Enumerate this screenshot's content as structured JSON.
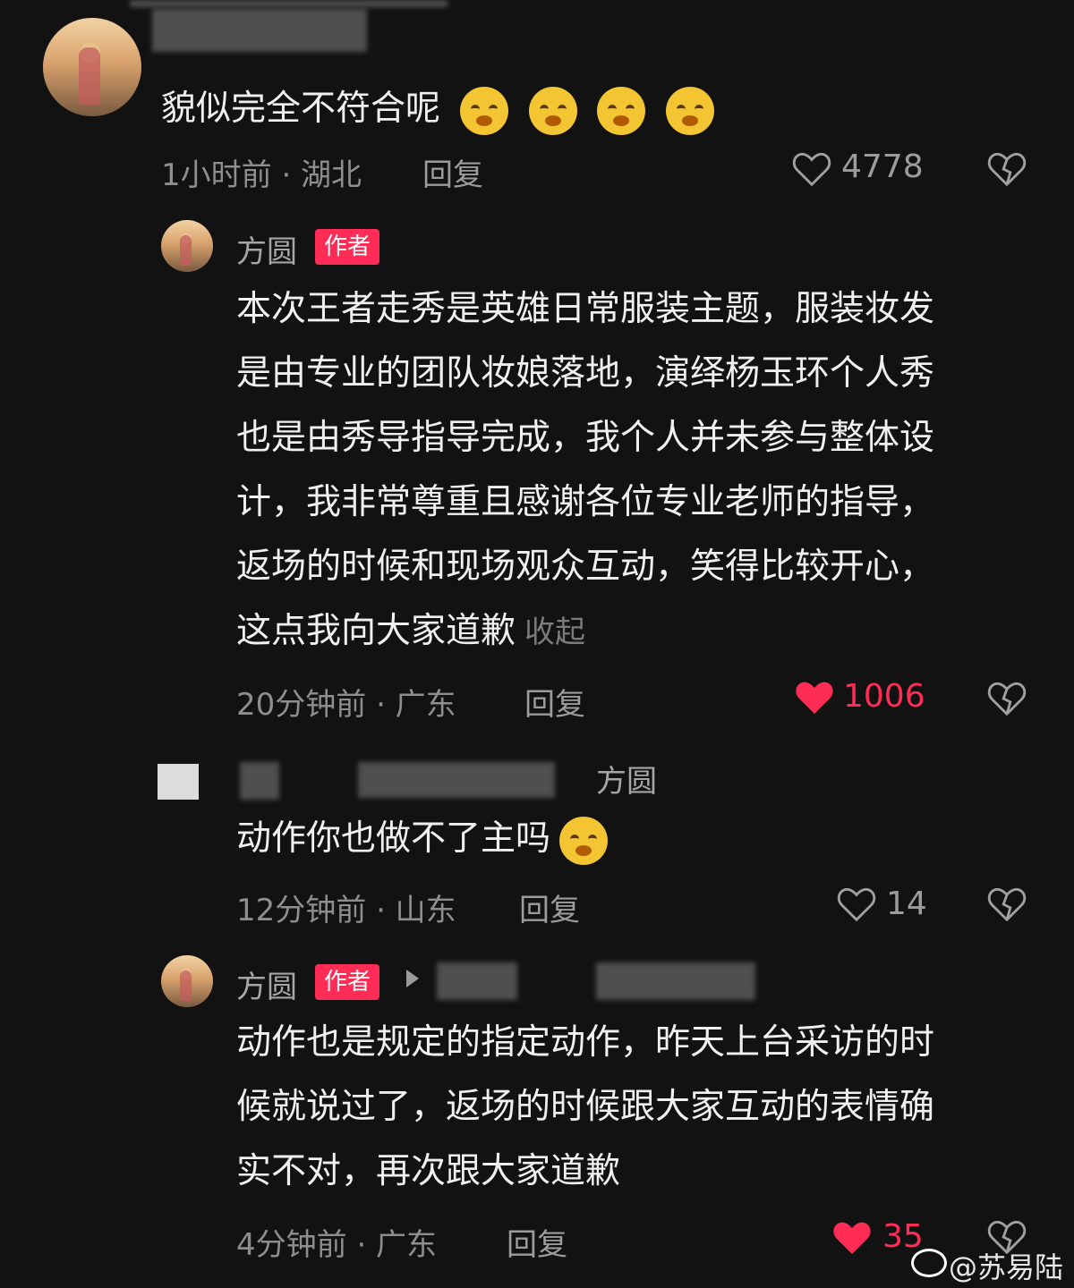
{
  "top_comment": {
    "text": "貌似完全不符合呢",
    "meta": "1小时前 · 湖北",
    "reply": "回复",
    "likes": "4778"
  },
  "reply1": {
    "name": "方圆",
    "badge": "作者",
    "lines": [
      "本次王者走秀是英雄日常服装主题，服装妆发",
      "是由专业的团队妆娘落地，演绎杨玉环个人秀",
      "也是由秀导指导完成，我个人并未参与整体设",
      "计，我非常尊重且感谢各位专业老师的指导，",
      "返场的时候和现场观众互动，笑得比较开心，",
      "这点我向大家道歉"
    ],
    "collapse": "收起",
    "meta": "20分钟前 · 广东",
    "reply": "回复",
    "likes": "1006"
  },
  "reply2": {
    "reply_to": "方圆",
    "text": "动作你也做不了主吗",
    "meta": "12分钟前 · 山东",
    "reply": "回复",
    "likes": "14"
  },
  "reply3": {
    "name": "方圆",
    "badge": "作者",
    "lines": [
      "动作也是规定的指定动作，昨天上台采访的时",
      "候就说过了，返场的时候跟大家互动的表情确",
      "实不对，再次跟大家道歉"
    ],
    "meta": "4分钟前 · 广东",
    "reply": "回复",
    "likes": "35"
  },
  "watermark": "@苏易陆",
  "colors": {
    "bg": "#121212",
    "accent": "#ff2d55"
  }
}
